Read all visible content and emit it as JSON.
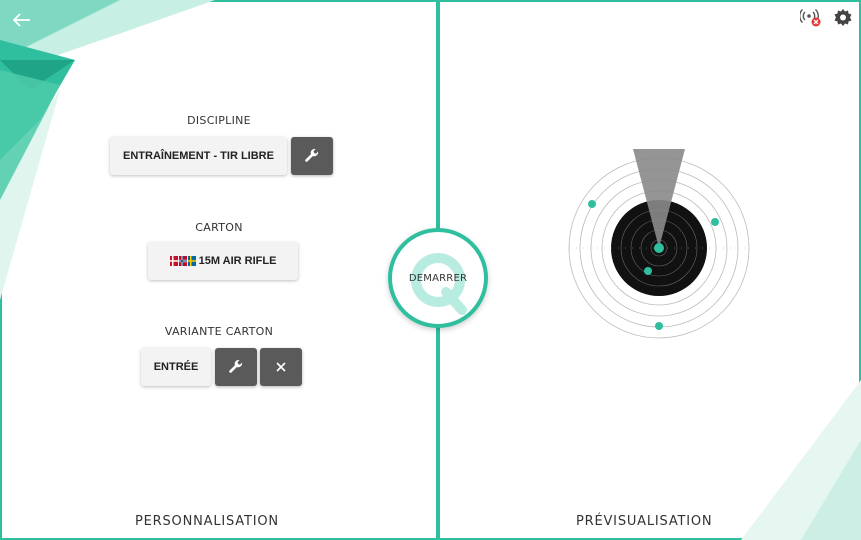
{
  "nav": {
    "back_icon": "arrow-left-icon"
  },
  "left_panel": {
    "discipline": {
      "label": "DISCIPLINE",
      "value": "ENTRAÎNEMENT - TIR LIBRE",
      "settings_icon": "wrench-icon"
    },
    "carton": {
      "label": "CARTON",
      "value": "15M AIR RIFLE",
      "flags_icon": "nordic-flags-icon"
    },
    "variante": {
      "label": "VARIANTE CARTON",
      "value": "ENTRÉE",
      "settings_icon": "wrench-icon",
      "clear_icon": "close-icon"
    },
    "footer_title": "PERSONNALISATION"
  },
  "start_button": {
    "label": "DEMARRER"
  },
  "right_panel": {
    "footer_title": "PRÉVISUALISATION",
    "status_icons": [
      "wireless-disconnected-icon",
      "gear-icon"
    ],
    "target_preview": {
      "shot_markers": [
        "1",
        "2",
        "3",
        "4",
        "5"
      ]
    }
  },
  "colors": {
    "accent": "#2fbf9f",
    "dark_button": "#5a5a5a",
    "error": "#e53935"
  }
}
